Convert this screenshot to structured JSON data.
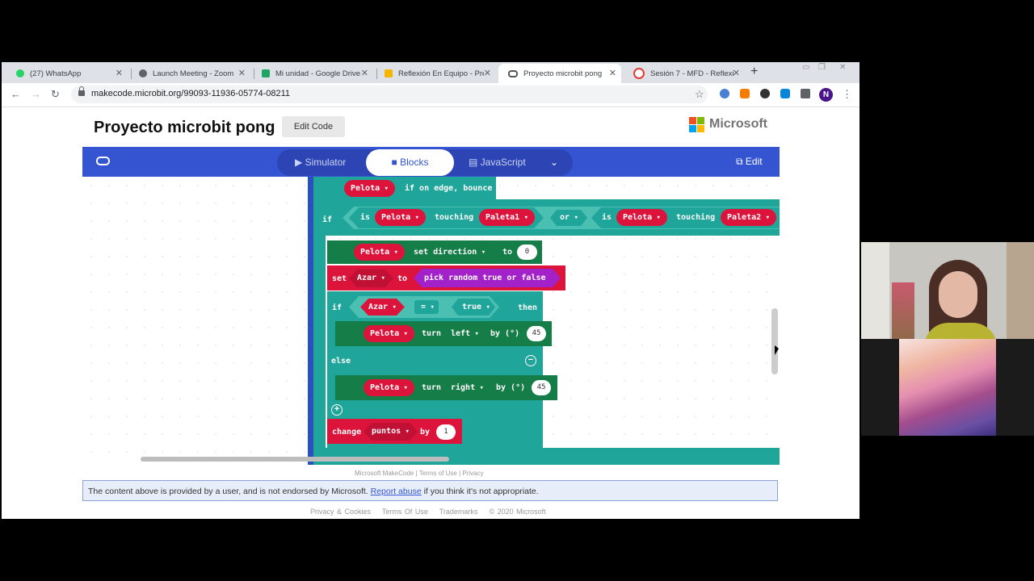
{
  "browser": {
    "tabs": [
      {
        "title": "(27) WhatsApp",
        "icon": "whatsapp-icon",
        "color": "#25d366"
      },
      {
        "title": "Launch Meeting - Zoom",
        "icon": "globe-icon",
        "color": "#5f6368"
      },
      {
        "title": "Mi unidad - Google Drive",
        "icon": "drive-icon",
        "color": "#1fa463"
      },
      {
        "title": "Reflexión En Equipo - Pre",
        "icon": "slides-icon",
        "color": "#f4b400"
      },
      {
        "title": "Proyecto microbit pong",
        "icon": "makecode-icon",
        "color": "#555"
      },
      {
        "title": "Sesión 7 - MFD - Reflexi",
        "icon": "target-icon",
        "color": "#e53935"
      }
    ],
    "url": "makecode.microbit.org/99093-11936-05774-08211",
    "profile_initial": "N"
  },
  "page": {
    "title": "Proyecto microbit pong",
    "edit_code": "Edit Code",
    "brand": "Microsoft"
  },
  "editor": {
    "modes": {
      "simulator": "Simulator",
      "blocks": "Blocks",
      "javascript": "JavaScript"
    },
    "edit": "Edit",
    "blocks": {
      "sprite": "Pelota",
      "if_on_edge": "if on edge, bounce",
      "if_kw": "if",
      "is_kw": "is",
      "touching": "touching",
      "paddle1": "Paleta1",
      "or_kw": "or",
      "paddle2": "Paleta2",
      "set_direction": "set direction",
      "to_kw": "to",
      "direction_value": "0",
      "set_kw": "set",
      "var_azar": "Azar",
      "pick_random": "pick random true or false",
      "eq_op": "=",
      "true_kw": "true",
      "then_kw": "then",
      "turn_kw": "turn",
      "left_kw": "left",
      "right_kw": "right",
      "by_deg": "by (°)",
      "angle_left": "45",
      "angle_right": "45",
      "else_kw": "else",
      "change_kw": "change",
      "var_puntos": "puntos",
      "by_kw": "by",
      "change_value": "1"
    }
  },
  "footer": {
    "makecode_links": "Microsoft MakeCode  |  Terms of Use  |  Privacy",
    "disclaimer_pre": "The content above is provided by a user, and is not endorsed by Microsoft.",
    "report_abuse": "Report abuse",
    "disclaimer_post": "if you think it's not appropriate.",
    "links": [
      "Privacy & Cookies",
      "Terms Of Use",
      "Trademarks",
      "© 2020 Microsoft"
    ]
  },
  "colors": {
    "accent": "#3454d1",
    "block_teal": "#1fa59a",
    "block_red": "#dc143c",
    "block_purple": "#a321c9"
  }
}
